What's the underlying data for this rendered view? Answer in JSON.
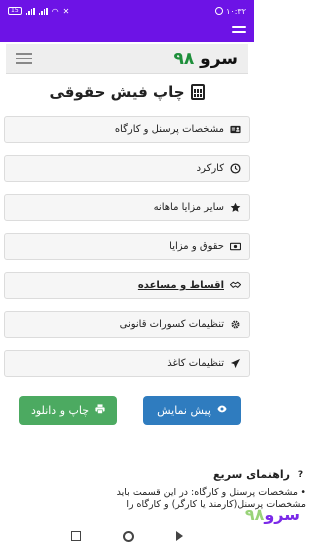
{
  "status": {
    "time": "۱۰:۳۲",
    "battery": "15"
  },
  "brand": {
    "name": "سرو",
    "number": "۹۸"
  },
  "page": {
    "title": "چاپ فیش حقوقی"
  },
  "menu_items": [
    {
      "label": "مشخصات پرسنل و کارگاه",
      "icon": "id-card-icon"
    },
    {
      "label": "کارکرد",
      "icon": "clock-icon"
    },
    {
      "label": "سایر مزایا ماهانه",
      "icon": "star-icon"
    },
    {
      "label": "حقوق و مزایا",
      "icon": "money-icon"
    },
    {
      "label": "اقساط و مساعده",
      "icon": "handshake-icon"
    },
    {
      "label": "تنظیمات کسورات قانونی",
      "icon": "gear-icon"
    },
    {
      "label": "تنظیمات کاغذ",
      "icon": "send-icon"
    }
  ],
  "buttons": {
    "preview": "پیش نمایش",
    "print": "چاپ و دانلود"
  },
  "guide": {
    "title": "راهنمای سریع",
    "text": "مشخصات پرسنل و کارگاه: در این قسمت باید مشخصات پرسنل(کارمند یا کارگر) و کارگاه را"
  },
  "colors": {
    "status_bar": "#6d13e6",
    "preview_button": "#2f7cbf",
    "print_button": "#4caa61",
    "brand_number": "#1e8f3b"
  }
}
